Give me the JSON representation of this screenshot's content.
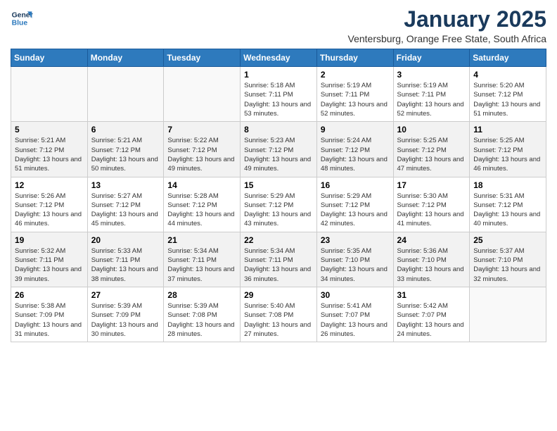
{
  "logo": {
    "line1": "General",
    "line2": "Blue"
  },
  "title": "January 2025",
  "location": "Ventersburg, Orange Free State, South Africa",
  "days_of_week": [
    "Sunday",
    "Monday",
    "Tuesday",
    "Wednesday",
    "Thursday",
    "Friday",
    "Saturday"
  ],
  "weeks": [
    [
      {
        "day": "",
        "info": ""
      },
      {
        "day": "",
        "info": ""
      },
      {
        "day": "",
        "info": ""
      },
      {
        "day": "1",
        "info": "Sunrise: 5:18 AM\nSunset: 7:11 PM\nDaylight: 13 hours and 53 minutes."
      },
      {
        "day": "2",
        "info": "Sunrise: 5:19 AM\nSunset: 7:11 PM\nDaylight: 13 hours and 52 minutes."
      },
      {
        "day": "3",
        "info": "Sunrise: 5:19 AM\nSunset: 7:11 PM\nDaylight: 13 hours and 52 minutes."
      },
      {
        "day": "4",
        "info": "Sunrise: 5:20 AM\nSunset: 7:12 PM\nDaylight: 13 hours and 51 minutes."
      }
    ],
    [
      {
        "day": "5",
        "info": "Sunrise: 5:21 AM\nSunset: 7:12 PM\nDaylight: 13 hours and 51 minutes."
      },
      {
        "day": "6",
        "info": "Sunrise: 5:21 AM\nSunset: 7:12 PM\nDaylight: 13 hours and 50 minutes."
      },
      {
        "day": "7",
        "info": "Sunrise: 5:22 AM\nSunset: 7:12 PM\nDaylight: 13 hours and 49 minutes."
      },
      {
        "day": "8",
        "info": "Sunrise: 5:23 AM\nSunset: 7:12 PM\nDaylight: 13 hours and 49 minutes."
      },
      {
        "day": "9",
        "info": "Sunrise: 5:24 AM\nSunset: 7:12 PM\nDaylight: 13 hours and 48 minutes."
      },
      {
        "day": "10",
        "info": "Sunrise: 5:25 AM\nSunset: 7:12 PM\nDaylight: 13 hours and 47 minutes."
      },
      {
        "day": "11",
        "info": "Sunrise: 5:25 AM\nSunset: 7:12 PM\nDaylight: 13 hours and 46 minutes."
      }
    ],
    [
      {
        "day": "12",
        "info": "Sunrise: 5:26 AM\nSunset: 7:12 PM\nDaylight: 13 hours and 46 minutes."
      },
      {
        "day": "13",
        "info": "Sunrise: 5:27 AM\nSunset: 7:12 PM\nDaylight: 13 hours and 45 minutes."
      },
      {
        "day": "14",
        "info": "Sunrise: 5:28 AM\nSunset: 7:12 PM\nDaylight: 13 hours and 44 minutes."
      },
      {
        "day": "15",
        "info": "Sunrise: 5:29 AM\nSunset: 7:12 PM\nDaylight: 13 hours and 43 minutes."
      },
      {
        "day": "16",
        "info": "Sunrise: 5:29 AM\nSunset: 7:12 PM\nDaylight: 13 hours and 42 minutes."
      },
      {
        "day": "17",
        "info": "Sunrise: 5:30 AM\nSunset: 7:12 PM\nDaylight: 13 hours and 41 minutes."
      },
      {
        "day": "18",
        "info": "Sunrise: 5:31 AM\nSunset: 7:12 PM\nDaylight: 13 hours and 40 minutes."
      }
    ],
    [
      {
        "day": "19",
        "info": "Sunrise: 5:32 AM\nSunset: 7:11 PM\nDaylight: 13 hours and 39 minutes."
      },
      {
        "day": "20",
        "info": "Sunrise: 5:33 AM\nSunset: 7:11 PM\nDaylight: 13 hours and 38 minutes."
      },
      {
        "day": "21",
        "info": "Sunrise: 5:34 AM\nSunset: 7:11 PM\nDaylight: 13 hours and 37 minutes."
      },
      {
        "day": "22",
        "info": "Sunrise: 5:34 AM\nSunset: 7:11 PM\nDaylight: 13 hours and 36 minutes."
      },
      {
        "day": "23",
        "info": "Sunrise: 5:35 AM\nSunset: 7:10 PM\nDaylight: 13 hours and 34 minutes."
      },
      {
        "day": "24",
        "info": "Sunrise: 5:36 AM\nSunset: 7:10 PM\nDaylight: 13 hours and 33 minutes."
      },
      {
        "day": "25",
        "info": "Sunrise: 5:37 AM\nSunset: 7:10 PM\nDaylight: 13 hours and 32 minutes."
      }
    ],
    [
      {
        "day": "26",
        "info": "Sunrise: 5:38 AM\nSunset: 7:09 PM\nDaylight: 13 hours and 31 minutes."
      },
      {
        "day": "27",
        "info": "Sunrise: 5:39 AM\nSunset: 7:09 PM\nDaylight: 13 hours and 30 minutes."
      },
      {
        "day": "28",
        "info": "Sunrise: 5:39 AM\nSunset: 7:08 PM\nDaylight: 13 hours and 28 minutes."
      },
      {
        "day": "29",
        "info": "Sunrise: 5:40 AM\nSunset: 7:08 PM\nDaylight: 13 hours and 27 minutes."
      },
      {
        "day": "30",
        "info": "Sunrise: 5:41 AM\nSunset: 7:07 PM\nDaylight: 13 hours and 26 minutes."
      },
      {
        "day": "31",
        "info": "Sunrise: 5:42 AM\nSunset: 7:07 PM\nDaylight: 13 hours and 24 minutes."
      },
      {
        "day": "",
        "info": ""
      }
    ]
  ]
}
